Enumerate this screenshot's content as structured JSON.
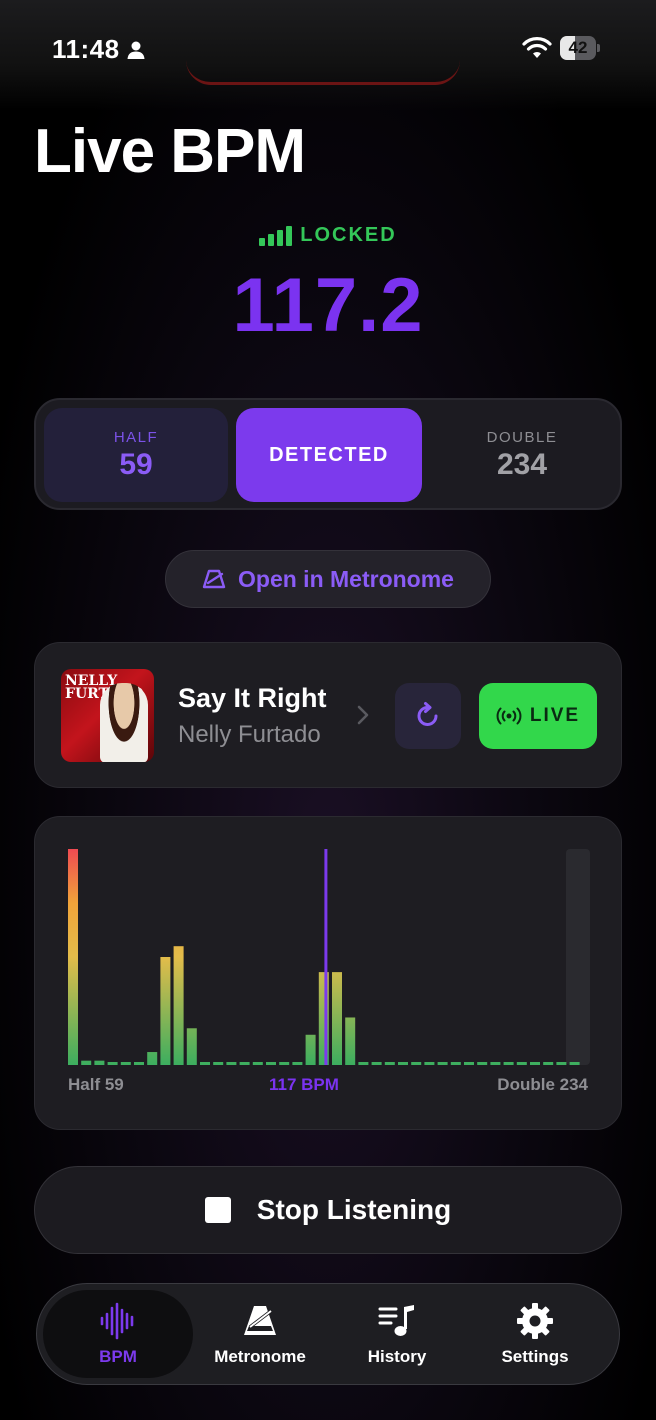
{
  "status_bar": {
    "time": "11:48",
    "battery": "42",
    "battery_level": 0.42
  },
  "header": {
    "title": "Live BPM"
  },
  "lock": {
    "label": "LOCKED"
  },
  "bpm": {
    "value": "117.2"
  },
  "tempo_selector": {
    "half": {
      "label": "HALF",
      "value": "59"
    },
    "detected": {
      "label": "DETECTED"
    },
    "double": {
      "label": "DOUBLE",
      "value": "234"
    }
  },
  "open_metronome": {
    "label": "Open in Metronome"
  },
  "track": {
    "title": "Say It Right",
    "artist": "Nelly Furtado",
    "album_art_text": "NELLY FURTADO"
  },
  "live_button": {
    "label": "LIVE"
  },
  "colors": {
    "accent": "#7c3aed",
    "live": "#32d74b",
    "locked": "#34c759"
  },
  "chart_data": {
    "type": "bar",
    "x_labels": {
      "left": "Half 59",
      "center": "117 BPM",
      "right": "Double 234"
    },
    "values": [
      1.0,
      0.02,
      0.02,
      0.01,
      0.01,
      0.01,
      0.06,
      0.5,
      0.55,
      0.17,
      0.01,
      0.01,
      0.01,
      0.01,
      0.01,
      0.01,
      0.01,
      0.01,
      0.14,
      0.43,
      0.43,
      0.22,
      0.01,
      0.01,
      0.01,
      0.01,
      0.01,
      0.01,
      0.01,
      0.01,
      0.01,
      0.01,
      0.01,
      0.01,
      0.01,
      0.01,
      0.01,
      0.01,
      0.01
    ],
    "marker_index": 19.5
  },
  "stop_button": {
    "label": "Stop Listening"
  },
  "tabbar": {
    "items": [
      {
        "label": "BPM",
        "icon": "waveform-icon",
        "active": true
      },
      {
        "label": "Metronome",
        "icon": "metronome-icon"
      },
      {
        "label": "History",
        "icon": "history-icon"
      },
      {
        "label": "Settings",
        "icon": "gear-icon"
      }
    ]
  }
}
